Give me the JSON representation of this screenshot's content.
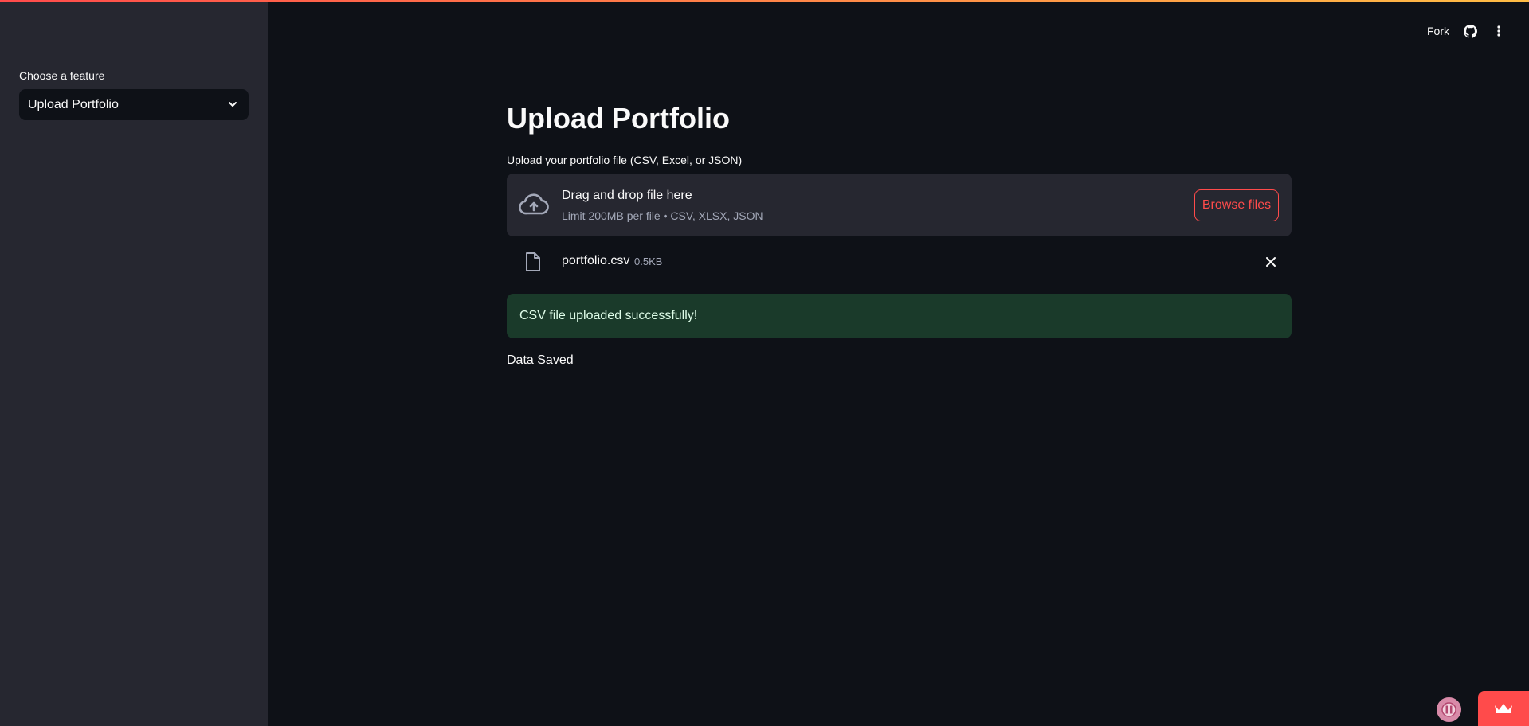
{
  "sidebar": {
    "select_label": "Choose a feature",
    "select_value": "Upload Portfolio"
  },
  "toolbar": {
    "fork_label": "Fork",
    "github_icon": "github-icon",
    "menu_icon": "kebab-menu-icon"
  },
  "main": {
    "title": "Upload Portfolio",
    "uploader_label": "Upload your portfolio file (CSV, Excel, or JSON)",
    "dropzone": {
      "instructions": "Drag and drop file here",
      "limits": "Limit 200MB per file • CSV, XLSX, JSON",
      "browse_label": "Browse files",
      "icon": "cloud-upload-icon"
    },
    "uploaded_file": {
      "name": "portfolio.csv",
      "size": "0.5KB",
      "icon": "file-icon"
    },
    "success_message": "CSV file uploaded successfully!",
    "status_text": "Data Saved"
  },
  "colors": {
    "accent": "#ff4b4b",
    "background": "#0e1117",
    "sidebar": "#262730",
    "success_bg": "#1a3a2a"
  }
}
